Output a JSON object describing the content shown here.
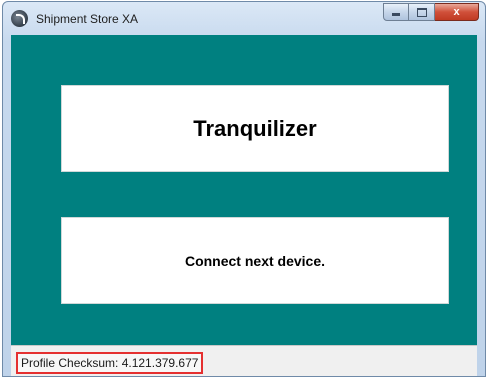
{
  "window": {
    "title": "Shipment Store XA",
    "app_icon": "app-logo-icon",
    "caption_buttons": [
      "minimize",
      "maximize",
      "close"
    ],
    "close_glyph": "x"
  },
  "main": {
    "product_name": "Tranquilizer",
    "instruction": "Connect next device."
  },
  "status": {
    "checksum_text": "Profile Checksum: 4.121.379.677"
  },
  "colors": {
    "client_background": "#008080",
    "panel_background": "#ffffff",
    "highlight_border": "#e53030"
  }
}
